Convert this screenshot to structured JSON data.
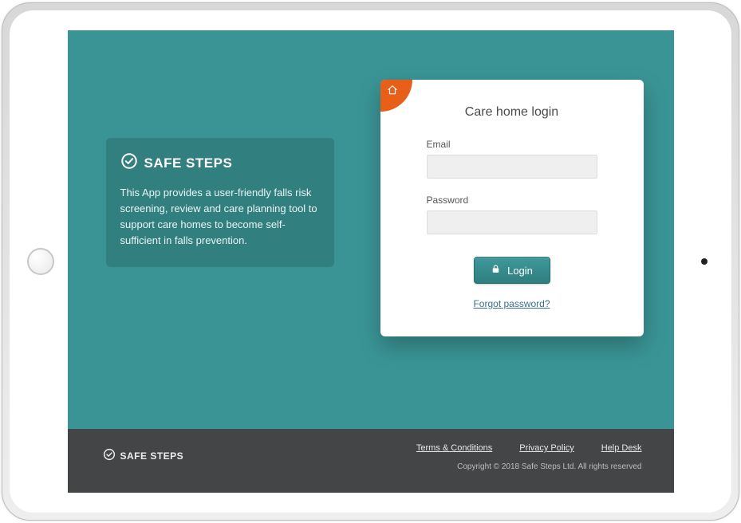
{
  "brand": {
    "name": "SAFE STEPS"
  },
  "info": {
    "description": "This App provides a user-friendly falls risk screening, review and care planning tool to support care homes to become self-sufficient in falls prevention."
  },
  "login": {
    "title": "Care home login",
    "email_label": "Email",
    "email_value": "",
    "password_label": "Password",
    "password_value": "",
    "button_label": "Login",
    "forgot_label": "Forgot password?"
  },
  "footer": {
    "links": {
      "terms": "Terms & Conditions",
      "privacy": "Privacy Policy",
      "help": "Help Desk"
    },
    "copyright": "Copyright © 2018 Safe Steps Ltd. All rights reserved"
  }
}
